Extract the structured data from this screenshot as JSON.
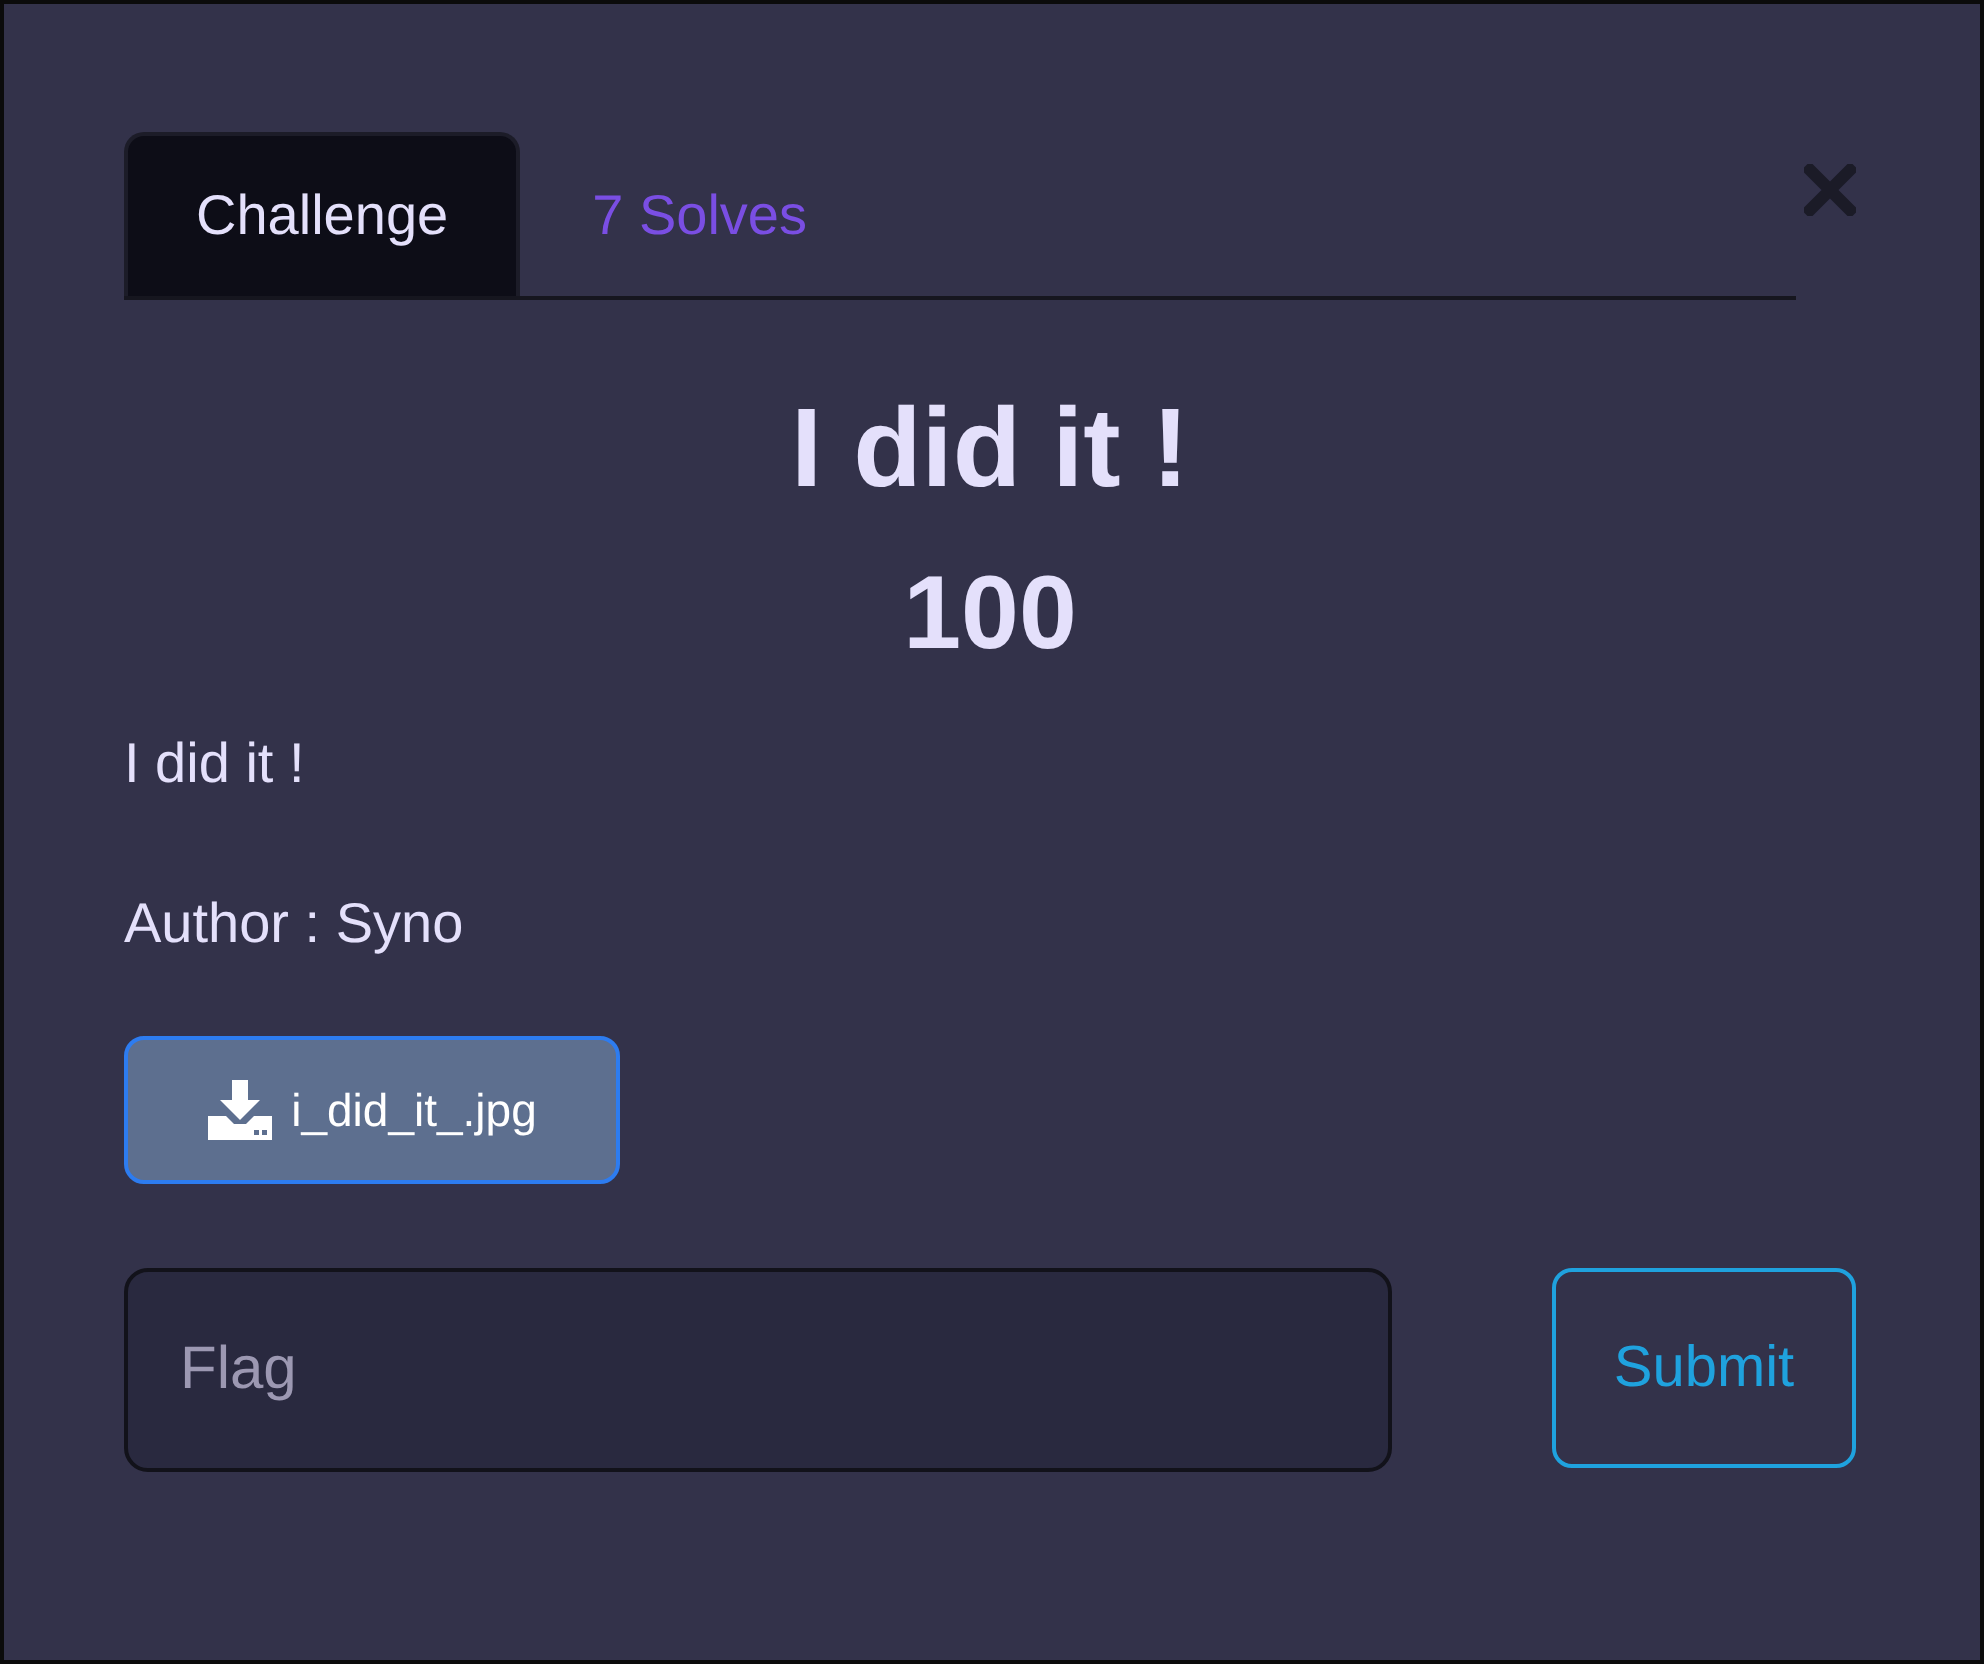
{
  "tabs": [
    {
      "label": "Challenge",
      "selected": true
    },
    {
      "label": "7 Solves",
      "selected": false
    }
  ],
  "challenge": {
    "name": "I did it !",
    "value": "100",
    "description": [
      "I did it !",
      "Author : Syno"
    ]
  },
  "files": [
    {
      "name": "i_did_it_.jpg"
    }
  ],
  "flag_field": {
    "placeholder": "Flag"
  },
  "submit_button": {
    "label": "Submit"
  }
}
